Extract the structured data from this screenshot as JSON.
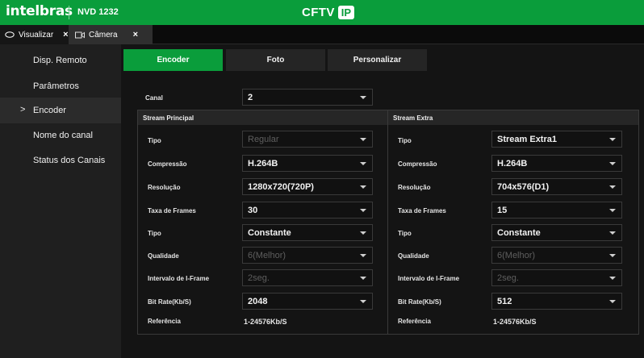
{
  "brand": {
    "logo": "intelbras",
    "model": "NVD 1232",
    "center_title": "CFTV",
    "center_badge": "IP",
    "accent": "#0a9d3b"
  },
  "tabs": [
    {
      "label": "Visualizar",
      "icon": "eye-icon",
      "close": "×"
    },
    {
      "label": "Câmera",
      "icon": "camera-icon",
      "close": "×"
    }
  ],
  "sidebar": {
    "items": [
      {
        "label": "Disp. Remoto"
      },
      {
        "label": "Parâmetros"
      },
      {
        "label": "Encoder",
        "active": true,
        "marker": ">"
      },
      {
        "label": "Nome do canal"
      },
      {
        "label": "Status dos Canais"
      }
    ]
  },
  "subtabs": [
    {
      "label": "Encoder",
      "active": true
    },
    {
      "label": "Foto"
    },
    {
      "label": "Personalizar"
    }
  ],
  "canal": {
    "label": "Canal",
    "value": "2"
  },
  "principal": {
    "title": "Stream Principal",
    "rows": [
      {
        "label": "Tipo",
        "value": "Regular",
        "disabled": true
      },
      {
        "label": "Compressão",
        "value": "H.264B"
      },
      {
        "label": "Resolução",
        "value": "1280x720(720P)"
      },
      {
        "label": "Taxa de Frames",
        "value": "30"
      },
      {
        "label": "Tipo",
        "value": "Constante"
      },
      {
        "label": "Qualidade",
        "value": "6(Melhor)",
        "disabled": true
      },
      {
        "label": "Intervalo de I-Frame",
        "value": "2seg.",
        "disabled": true
      },
      {
        "label": "Bit Rate(Kb/S)",
        "value": "2048"
      }
    ],
    "reference_label": "Referência",
    "reference_value": "1-24576Kb/S"
  },
  "extra": {
    "title": "Stream Extra",
    "rows": [
      {
        "label": "Tipo",
        "value": "Stream Extra1"
      },
      {
        "label": "Compressão",
        "value": "H.264B"
      },
      {
        "label": "Resolução",
        "value": "704x576(D1)"
      },
      {
        "label": "Taxa de Frames",
        "value": "15"
      },
      {
        "label": "Tipo",
        "value": "Constante"
      },
      {
        "label": "Qualidade",
        "value": "6(Melhor)",
        "disabled": true
      },
      {
        "label": "Intervalo de I-Frame",
        "value": "2seg.",
        "disabled": true
      },
      {
        "label": "Bit Rate(Kb/S)",
        "value": "512"
      }
    ],
    "reference_label": "Referência",
    "reference_value": "1-24576Kb/S"
  }
}
